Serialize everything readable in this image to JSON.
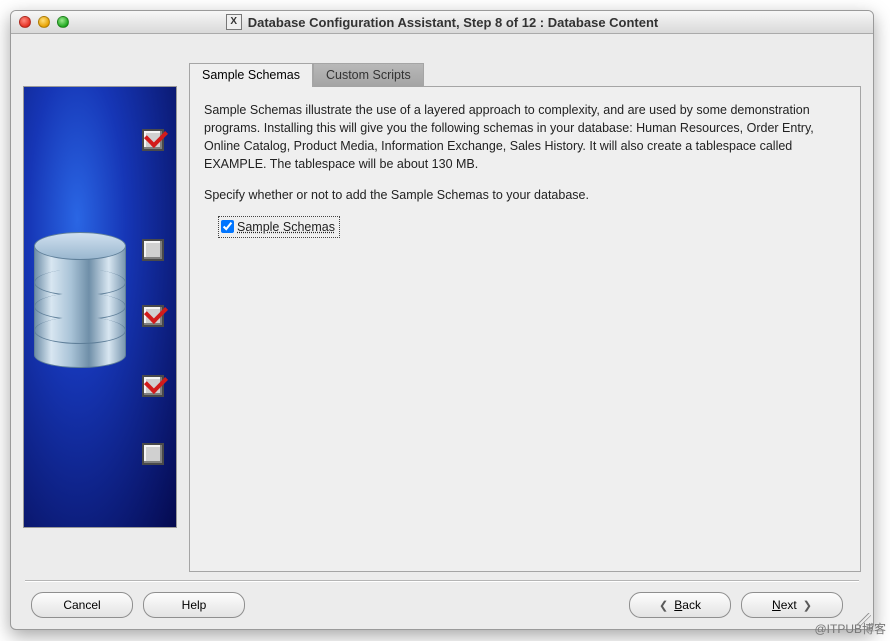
{
  "window": {
    "title": "Database Configuration Assistant, Step 8 of 12 : Database Content",
    "app_icon_letter": "X"
  },
  "tabs": [
    {
      "id": "sample-schemas",
      "label": "Sample Schemas",
      "active": true
    },
    {
      "id": "custom-scripts",
      "label": "Custom Scripts",
      "active": false
    }
  ],
  "panel": {
    "description": "Sample Schemas illustrate the use of a layered approach to complexity, and are used by some demonstration programs. Installing this will give you the following schemas in your database: Human Resources, Order Entry, Online Catalog, Product Media, Information Exchange, Sales History. It will also create a tablespace called EXAMPLE. The tablespace will be about 130 MB.",
    "prompt": "Specify whether or not to add the Sample Schemas to your database.",
    "checkbox_label": "Sample Schemas",
    "checkbox_checked": true
  },
  "buttons": {
    "cancel": "Cancel",
    "help": "Help",
    "back": "Back",
    "next": "Next"
  },
  "side_illustration": {
    "checkboxes": [
      {
        "checked": true
      },
      {
        "checked": false
      },
      {
        "checked": true
      },
      {
        "checked": true
      },
      {
        "checked": false
      }
    ]
  },
  "watermark": "@ITPUB博客"
}
